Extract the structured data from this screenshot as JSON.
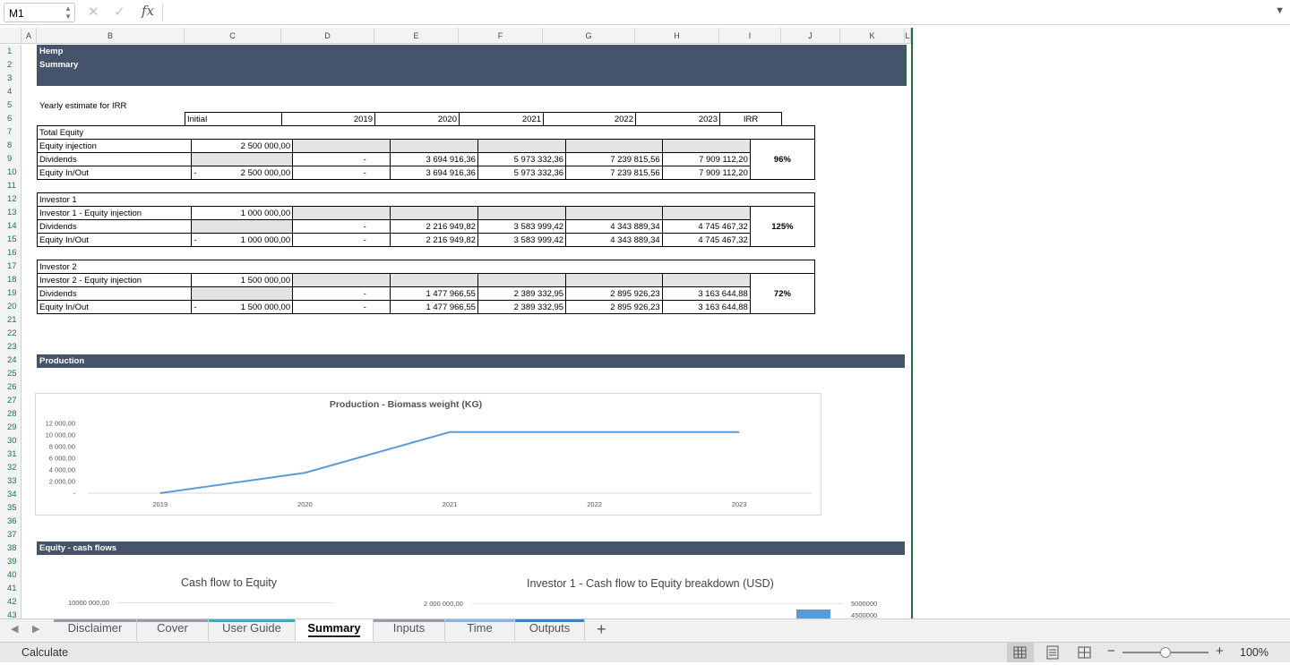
{
  "formula_bar": {
    "name_box": "M1",
    "cancel_icon": "✕",
    "confirm_icon": "✓",
    "fx_label": "fx",
    "formula": ""
  },
  "columns": [
    {
      "label": "A"
    },
    {
      "label": "B"
    },
    {
      "label": "C"
    },
    {
      "label": "D"
    },
    {
      "label": "E"
    },
    {
      "label": "F"
    },
    {
      "label": "G"
    },
    {
      "label": "H"
    },
    {
      "label": "I"
    },
    {
      "label": "J"
    },
    {
      "label": "K"
    },
    {
      "label": "L"
    }
  ],
  "rows": [
    "1",
    "2",
    "3",
    "4",
    "5",
    "6",
    "7",
    "8",
    "9",
    "10",
    "11",
    "12",
    "13",
    "14",
    "15",
    "16",
    "17",
    "18",
    "19",
    "20",
    "21",
    "22",
    "23",
    "24",
    "25",
    "26",
    "27",
    "28",
    "29",
    "30",
    "31",
    "32",
    "33",
    "34",
    "35",
    "36",
    "37",
    "38",
    "39",
    "40",
    "41",
    "42",
    "43"
  ],
  "header": {
    "title": "Hemp",
    "subtitle": "Summary"
  },
  "irr_section": {
    "label": "Yearly estimate for IRR",
    "columns": [
      "Initial",
      "2019",
      "2020",
      "2021",
      "2022",
      "2023",
      "IRR"
    ],
    "tables": [
      {
        "title": "Total Equity",
        "injection_label": "Equity injection",
        "injection": "2 500 000,00",
        "dividends_label": "Dividends",
        "dividends": [
          "-",
          "3 694 916,36",
          "5 973 332,36",
          "7 239 815,56",
          "7 909 112,20"
        ],
        "inout_label": "Equity In/Out",
        "inout_sign": "-",
        "inout_initial": "2 500 000,00",
        "inout": [
          "-",
          "3 694 916,36",
          "5 973 332,36",
          "7 239 815,56",
          "7 909 112,20"
        ],
        "irr": "96%"
      },
      {
        "title": "Investor 1",
        "injection_label": "Investor 1 - Equity injection",
        "injection": "1 000 000,00",
        "dividends_label": "Dividends",
        "dividends": [
          "-",
          "2 216 949,82",
          "3 583 999,42",
          "4 343 889,34",
          "4 745 467,32"
        ],
        "inout_label": "Equity In/Out",
        "inout_sign": "-",
        "inout_initial": "1 000 000,00",
        "inout": [
          "-",
          "2 216 949,82",
          "3 583 999,42",
          "4 343 889,34",
          "4 745 467,32"
        ],
        "irr": "125%"
      },
      {
        "title": "Investor 2",
        "injection_label": "Investor 2 - Equity injection",
        "injection": "1 500 000,00",
        "dividends_label": "Dividends",
        "dividends": [
          "-",
          "1 477 966,55",
          "2 389 332,95",
          "2 895 926,23",
          "3 163 644,88"
        ],
        "inout_label": "Equity In/Out",
        "inout_sign": "-",
        "inout_initial": "1 500 000,00",
        "inout": [
          "-",
          "1 477 966,55",
          "2 389 332,95",
          "2 895 926,23",
          "3 163 644,88"
        ],
        "irr": "72%"
      }
    ]
  },
  "sections": {
    "production": "Production",
    "equity_cash_flows": "Equity - cash flows"
  },
  "chart_data": [
    {
      "type": "line",
      "title": "Production - Biomass weight (KG)",
      "categories": [
        "2019",
        "2020",
        "2021",
        "2022",
        "2023"
      ],
      "series": [
        {
          "values": [
            0,
            3500,
            10500,
            10500,
            10500
          ]
        }
      ],
      "ylim": [
        0,
        12000
      ],
      "yticks": [
        "12 000,00",
        "10 000,00",
        "8 000,00",
        "6 000,00",
        "4 000,00",
        "2 000,00",
        "-"
      ],
      "color": "#5b9bd5",
      "grid": false
    },
    {
      "type": "bar",
      "title": "Cash flow to Equity",
      "yticks": [
        "10000 000,00"
      ]
    },
    {
      "type": "bar",
      "title": "Investor 1 - Cash flow to Equity breakdown (USD)",
      "yticks_left": [
        "2 000 000,00"
      ],
      "yticks_right": [
        "5000000",
        "4500000"
      ],
      "color": "#5b9bd5"
    }
  ],
  "tabs": [
    {
      "label": "Disclaimer",
      "color": "#9b9bab"
    },
    {
      "label": "Cover",
      "color": "#9b9bab"
    },
    {
      "label": "User Guide",
      "color": "#4ba3b8"
    },
    {
      "label": "Summary",
      "color": "#ffffff",
      "active": true
    },
    {
      "label": "Inputs",
      "color": "#9b9bab"
    },
    {
      "label": "Time",
      "color": "#8fb6d9"
    },
    {
      "label": "Outputs",
      "color": "#4a7fbf"
    }
  ],
  "add_sheet": "+",
  "status": {
    "mode": "Calculate",
    "zoom": "100%",
    "zoom_minus": "−",
    "zoom_plus": "+",
    "zoom_level": 0.5
  }
}
